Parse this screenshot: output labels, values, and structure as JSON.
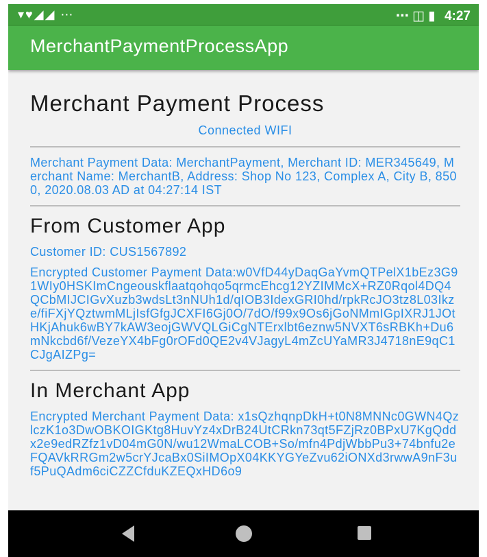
{
  "status_bar": {
    "left_icons": "▾♥◢◢ ⋯",
    "right_icons": "⋯ ◫ ▮",
    "time": "4:27"
  },
  "app_bar": {
    "title": "MerchantPaymentProcessApp"
  },
  "main": {
    "title": "Merchant Payment Process",
    "connection_status": "Connected WIFI",
    "merchant_payment_data": "Merchant Payment Data: MerchantPayment, Merchant ID: MER345649, Merchant Name: MerchantB, Address: Shop No 123, Complex A, City B, 8500, 2020.08.03 AD at 04:27:14 IST",
    "from_customer": {
      "heading": "From Customer App",
      "customer_id": "Customer ID: CUS1567892",
      "encrypted_label": "Encrypted Customer Payment Data:",
      "encrypted_value": "w0VfD44yDaqGaYvmQTPelX1bEz3G91WIy0HSKImCngeouskflaatqohqo5qrmcEhcg12YZIMMcX+RZ0Rqol4DQ4QCbMIJCIGvXuzb3wdsLt3nNUh1d/qIOB3IdexGRI0hd/rpkRcJO3tz8L03Ikze/fiFXjYQztwmMLjIsfGfgJCXFI6Gj0O/7dO/f99x9Os6jGoNMmIGpIXRJ1JOtHKjAhuk6wBY7kAW3eojGWVQLGiCgNTErxlbt6eznw5NVXT6sRBKh+Du6mNkcbd6f/VezeYX4bFg0rOFd0QE2v4VJagyL4mZcUYaMR3J4718nE9qC1CJgAIZPg="
    },
    "in_merchant": {
      "heading": "In Merchant App",
      "encrypted_label": "Encrypted Merchant Payment Data:",
      "encrypted_value": "x1sQzhqnpDkH+t0N8MNNc0GWN4QzlczK1o3DwOBKOIGKtg8HuvYz4xDrB24UtCRkn73qt5FZjRz0BPxU7KgQddx2e9edRZfz1vD04mG0N/wu12WmaLCOB+So/mfn4PdjWbbPu3+74bnfu2eFQAVkRRGm2w5crYJcaBx0SiIMOpX04KKYGYeZvu62iONXd3rwwA9nF3uf5PuQAdm6ciCZZCfduKZEQxHD6o9"
    }
  },
  "nav_bar": {
    "back": "back-triangle",
    "home": "home-circle",
    "recents": "recents-square"
  }
}
